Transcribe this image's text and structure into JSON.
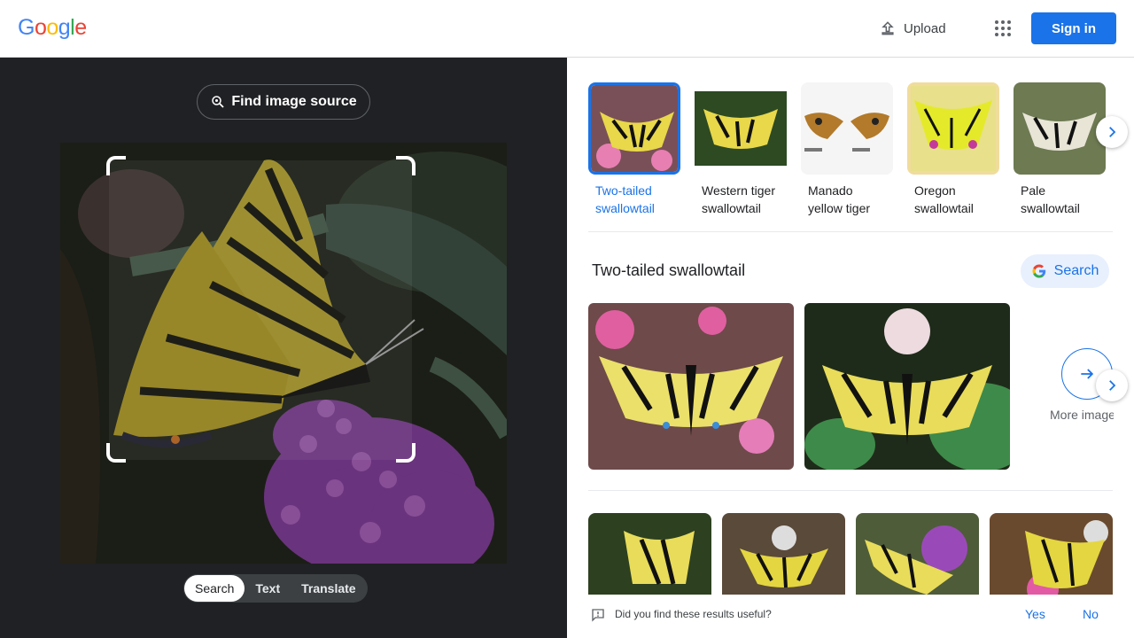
{
  "header": {
    "logo_letters": [
      "G",
      "o",
      "o",
      "g",
      "l",
      "e"
    ],
    "logo_colors": [
      "#4285f4",
      "#ea4335",
      "#fbbc05",
      "#4285f4",
      "#34a853",
      "#ea4335"
    ],
    "upload_label": "Upload",
    "signin_label": "Sign in",
    "apps_icon": "apps-grid-icon"
  },
  "left_panel": {
    "find_source_label": "Find image source",
    "modes": [
      {
        "label": "Search",
        "active": true
      },
      {
        "label": "Text",
        "active": false
      },
      {
        "label": "Translate",
        "active": false
      }
    ]
  },
  "right_panel": {
    "matches": [
      {
        "line1": "Two-tailed",
        "line2": "swallowtail",
        "selected": true
      },
      {
        "line1": "Western tiger",
        "line2": "swallowtail",
        "selected": false
      },
      {
        "line1": "Manado",
        "line2": "yellow tiger",
        "selected": false
      },
      {
        "line1": "Oregon",
        "line2": "swallowtail",
        "selected": false
      },
      {
        "line1": "Pale",
        "line2": "swallowtail",
        "selected": false
      }
    ],
    "section_title": "Two-tailed swallowtail",
    "search_button_label": "Search",
    "more_images_label": "More images",
    "feedback": {
      "question": "Did you find these results useful?",
      "yes": "Yes",
      "no": "No"
    }
  },
  "colors": {
    "accent": "#1a73e8",
    "left_bg": "#202124"
  }
}
